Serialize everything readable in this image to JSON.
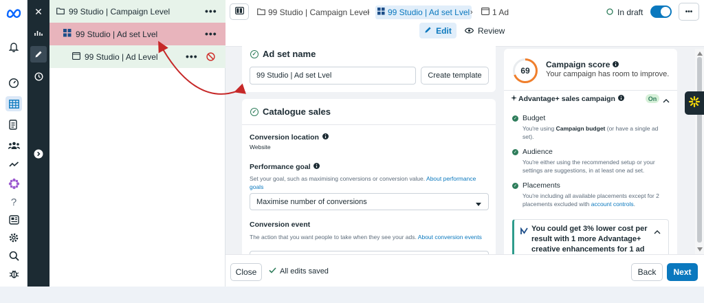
{
  "leftbar": {
    "icons": [
      "meta-logo-icon",
      "bell-icon",
      "gauge-icon",
      "grid-table-icon",
      "pages-icon",
      "people-icon",
      "trend-icon",
      "flower-icon",
      "help-icon",
      "news-icon",
      "settings-icon",
      "search-icon",
      "bug-icon"
    ],
    "help_glyph": "?"
  },
  "darkbar": {
    "close_glyph": "✕"
  },
  "tree": {
    "campaign": "99 Studio | Campaign Level",
    "adset": "99 Studio | Ad set Lvel",
    "ad": "99 Studio | Ad Level",
    "dots": "•••"
  },
  "header": {
    "crumb_campaign": "99 Studio | Campaign Level",
    "crumb_adset": "99 Studio | Ad set Lvel",
    "crumb_ad": "1 Ad",
    "status": "In draft",
    "dots": "•••",
    "tab_edit": "Edit",
    "tab_review": "Review"
  },
  "adset_card": {
    "title": "Ad set name",
    "name_value": "99 Studio | Ad set Lvel",
    "create_template": "Create template"
  },
  "catalogue_card": {
    "title": "Catalogue sales",
    "conversion_location_label": "Conversion location",
    "conversion_location_value": "Website",
    "performance_goal_label": "Performance goal",
    "performance_goal_help": "Set your goal, such as maximising conversions or conversion value.",
    "performance_goal_link": "About performance goals",
    "performance_goal_value": "Maximise number of conversions",
    "conversion_event_label": "Conversion event",
    "conversion_event_help": "The action that you want people to take when they see your ads.",
    "conversion_event_link": "About conversion events"
  },
  "score_panel": {
    "score": "69",
    "score_fraction": 0.69,
    "title": "Campaign score",
    "subtitle": "Your campaign has room to improve.",
    "advantage_title": "Advantage+ sales campaign",
    "advantage_badge": "On",
    "budget_title": "Budget",
    "budget_text_a": "You're using",
    "budget_text_b": "Campaign budget",
    "budget_text_c": "(or have a single ad set).",
    "audience_title": "Audience",
    "audience_text": "You're either using the recommended setup or your settings are suggestions, in at least one ad set.",
    "placements_title": "Placements",
    "placements_text": "You're including all available placements except for 2 placements excluded with",
    "placements_link": "account controls",
    "tip_text": "You could get 3% lower cost per result with 1 more Advantage+ creative enhancements for 1 ad"
  },
  "footer": {
    "close": "Close",
    "saved": "All edits saved",
    "back": "Back",
    "next": "Next"
  },
  "colors": {
    "accent": "#0a78be",
    "highlight": "#e8b4bc",
    "tree_selected": "#e7f3ea",
    "dark_rail": "#1c2b33",
    "success": "#2e7d5b",
    "arrow": "#c62828"
  }
}
